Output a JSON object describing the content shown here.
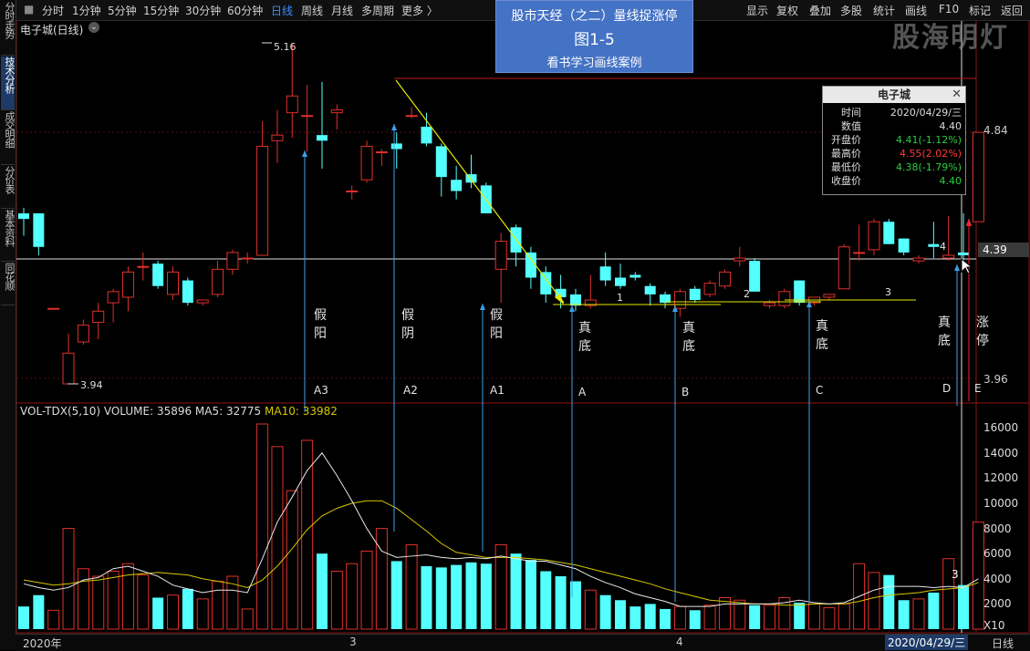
{
  "toolbar": {
    "items": [
      "分时",
      "1分钟",
      "5分钟",
      "15分钟",
      "30分钟",
      "60分钟",
      "日线",
      "周线",
      "月线",
      "多周期",
      "更多 〉"
    ],
    "right_items": [
      "显示",
      "复权",
      "叠加",
      "多股",
      "统计",
      "画线",
      "F10",
      "标记",
      "返回"
    ]
  },
  "left_tabs": [
    "分时走势",
    "技术分析",
    "成交明细",
    "分价表",
    "基本资料",
    "同花顺"
  ],
  "chart_header": {
    "stock_title": "电子城(日线)"
  },
  "banner": {
    "line1": "股市天经（之二）量线捉涨停",
    "line2": "图1-5",
    "line3": "看书学习画线案例"
  },
  "watermark": "股海明灯",
  "info_box": {
    "title": "电子城",
    "rows": [
      {
        "k": "时间",
        "v": "2020/04/29/三",
        "color": "#dddddd"
      },
      {
        "k": "数值",
        "v": "4.40",
        "color": "#dddddd"
      },
      {
        "k": "开盘价",
        "v": "4.41(-1.12%)",
        "color": "#2ecc40"
      },
      {
        "k": "最高价",
        "v": "4.55(2.02%)",
        "color": "#ff3b3b"
      },
      {
        "k": "最低价",
        "v": "4.38(-1.79%)",
        "color": "#2ecc40"
      },
      {
        "k": "收盘价",
        "v": "4.40",
        "color": "#2ecc40"
      }
    ]
  },
  "price_axis": {
    "labels": [
      "4.84",
      "4.39",
      "3.96"
    ]
  },
  "price_marks": {
    "high": "5.16",
    "low": "3.94"
  },
  "annotations": {
    "vertical_texts": [
      {
        "text": "假阳",
        "label": "A3"
      },
      {
        "text": "假阴",
        "label": "A2"
      },
      {
        "text": "假阳",
        "label": "A1"
      },
      {
        "text": "真底",
        "label": "A"
      },
      {
        "text": "真底",
        "label": "B"
      },
      {
        "text": "真底",
        "label": "C"
      },
      {
        "text": "真底",
        "label": "D"
      },
      {
        "text": "涨停",
        "label": "E"
      }
    ],
    "line_nums": [
      "1",
      "2",
      "3",
      "4"
    ]
  },
  "volume": {
    "header": "VOL-TDX(5,10) VOLUME: 35896 MA5: 32775",
    "ma10_label": "MA10: 33982",
    "axis_labels": [
      "16000",
      "14000",
      "12000",
      "10000",
      "8000",
      "6000",
      "4000",
      "2000"
    ],
    "unit": "X10",
    "marker3": "3"
  },
  "date_axis": {
    "labels": [
      "2020年",
      "3",
      "4"
    ],
    "current": "2020/04/29/三",
    "period": "日线"
  },
  "colors": {
    "up": "#e0302a",
    "down": "#54ffff",
    "ma5": "#e8e8e8",
    "ma10": "#d8c800",
    "accent": "#3a8cff"
  },
  "chart_data": {
    "type": "candlestick",
    "candles": [
      {
        "o": 4.55,
        "h": 4.57,
        "l": 4.47,
        "c": 4.53
      },
      {
        "o": 4.55,
        "h": 4.55,
        "l": 4.4,
        "c": 4.43
      },
      {
        "o": 4.21,
        "h": 4.21,
        "l": 4.21,
        "c": 4.21
      },
      {
        "o": 3.94,
        "h": 4.12,
        "l": 3.94,
        "c": 4.05
      },
      {
        "o": 4.09,
        "h": 4.17,
        "l": 4.08,
        "c": 4.15
      },
      {
        "o": 4.16,
        "h": 4.23,
        "l": 4.1,
        "c": 4.2
      },
      {
        "o": 4.23,
        "h": 4.28,
        "l": 4.16,
        "c": 4.27
      },
      {
        "o": 4.25,
        "h": 4.36,
        "l": 4.2,
        "c": 4.34
      },
      {
        "o": 4.36,
        "h": 4.41,
        "l": 4.31,
        "c": 4.36
      },
      {
        "o": 4.37,
        "h": 4.38,
        "l": 4.28,
        "c": 4.29
      },
      {
        "o": 4.26,
        "h": 4.36,
        "l": 4.24,
        "c": 4.34
      },
      {
        "o": 4.31,
        "h": 4.32,
        "l": 4.22,
        "c": 4.23
      },
      {
        "o": 4.23,
        "h": 4.24,
        "l": 4.22,
        "c": 4.24
      },
      {
        "o": 4.26,
        "h": 4.38,
        "l": 4.25,
        "c": 4.35
      },
      {
        "o": 4.35,
        "h": 4.42,
        "l": 4.33,
        "c": 4.41
      },
      {
        "o": 4.39,
        "h": 4.41,
        "l": 4.37,
        "c": 4.39
      },
      {
        "o": 4.4,
        "h": 4.88,
        "l": 4.4,
        "c": 4.79
      },
      {
        "o": 4.81,
        "h": 4.92,
        "l": 4.73,
        "c": 4.83
      },
      {
        "o": 4.91,
        "h": 5.16,
        "l": 4.82,
        "c": 4.97
      },
      {
        "o": 4.9,
        "h": 5.01,
        "l": 4.77,
        "c": 4.9
      },
      {
        "o": 4.83,
        "h": 5.02,
        "l": 4.71,
        "c": 4.81
      },
      {
        "o": 4.91,
        "h": 4.94,
        "l": 4.85,
        "c": 4.92
      },
      {
        "o": 4.63,
        "h": 4.65,
        "l": 4.6,
        "c": 4.63
      },
      {
        "o": 4.67,
        "h": 4.81,
        "l": 4.66,
        "c": 4.79
      },
      {
        "o": 4.77,
        "h": 4.78,
        "l": 4.72,
        "c": 4.77
      },
      {
        "o": 4.8,
        "h": 4.84,
        "l": 4.71,
        "c": 4.78
      },
      {
        "o": 4.9,
        "h": 4.93,
        "l": 4.89,
        "c": 4.9
      },
      {
        "o": 4.86,
        "h": 4.91,
        "l": 4.79,
        "c": 4.8
      },
      {
        "o": 4.79,
        "h": 4.8,
        "l": 4.61,
        "c": 4.68
      },
      {
        "o": 4.67,
        "h": 4.72,
        "l": 4.6,
        "c": 4.63
      },
      {
        "o": 4.69,
        "h": 4.76,
        "l": 4.64,
        "c": 4.66
      },
      {
        "o": 4.65,
        "h": 4.66,
        "l": 4.55,
        "c": 4.55
      },
      {
        "o": 4.35,
        "h": 4.48,
        "l": 4.23,
        "c": 4.45
      },
      {
        "o": 4.5,
        "h": 4.51,
        "l": 4.36,
        "c": 4.41
      },
      {
        "o": 4.41,
        "h": 4.43,
        "l": 4.28,
        "c": 4.32
      },
      {
        "o": 4.34,
        "h": 4.36,
        "l": 4.23,
        "c": 4.26
      },
      {
        "o": 4.28,
        "h": 4.33,
        "l": 4.21,
        "c": 4.25
      },
      {
        "o": 4.26,
        "h": 4.28,
        "l": 4.2,
        "c": 4.22
      },
      {
        "o": 4.22,
        "h": 4.33,
        "l": 4.21,
        "c": 4.24
      },
      {
        "o": 4.36,
        "h": 4.41,
        "l": 4.29,
        "c": 4.31
      },
      {
        "o": 4.32,
        "h": 4.37,
        "l": 4.28,
        "c": 4.29
      },
      {
        "o": 4.33,
        "h": 4.34,
        "l": 4.31,
        "c": 4.32
      },
      {
        "o": 4.29,
        "h": 4.3,
        "l": 4.22,
        "c": 4.26
      },
      {
        "o": 4.26,
        "h": 4.27,
        "l": 4.21,
        "c": 4.23
      },
      {
        "o": 4.21,
        "h": 4.28,
        "l": 4.18,
        "c": 4.27
      },
      {
        "o": 4.28,
        "h": 4.29,
        "l": 4.23,
        "c": 4.24
      },
      {
        "o": 4.26,
        "h": 4.31,
        "l": 4.25,
        "c": 4.3
      },
      {
        "o": 4.29,
        "h": 4.35,
        "l": 4.28,
        "c": 4.34
      },
      {
        "o": 4.38,
        "h": 4.43,
        "l": 4.36,
        "c": 4.39
      },
      {
        "o": 4.38,
        "h": 4.39,
        "l": 4.27,
        "c": 4.27
      },
      {
        "o": 4.22,
        "h": 4.24,
        "l": 4.21,
        "c": 4.23
      },
      {
        "o": 4.22,
        "h": 4.28,
        "l": 4.21,
        "c": 4.27
      },
      {
        "o": 4.31,
        "h": 4.31,
        "l": 4.22,
        "c": 4.23
      },
      {
        "o": 4.23,
        "h": 4.25,
        "l": 4.22,
        "c": 4.25
      },
      {
        "o": 4.25,
        "h": 4.26,
        "l": 4.24,
        "c": 4.26
      },
      {
        "o": 4.28,
        "h": 4.44,
        "l": 4.28,
        "c": 4.43
      },
      {
        "o": 4.41,
        "h": 4.51,
        "l": 4.38,
        "c": 4.41
      },
      {
        "o": 4.42,
        "h": 4.53,
        "l": 4.4,
        "c": 4.52
      },
      {
        "o": 4.52,
        "h": 4.53,
        "l": 4.44,
        "c": 4.44
      },
      {
        "o": 4.46,
        "h": 4.46,
        "l": 4.4,
        "c": 4.41
      },
      {
        "o": 4.38,
        "h": 4.4,
        "l": 4.37,
        "c": 4.39
      },
      {
        "o": 4.44,
        "h": 4.52,
        "l": 4.39,
        "c": 4.43
      },
      {
        "o": 4.39,
        "h": 4.54,
        "l": 4.38,
        "c": 4.4
      },
      {
        "o": 4.41,
        "h": 4.55,
        "l": 4.38,
        "c": 4.4
      },
      {
        "o": 4.52,
        "h": 4.84,
        "l": 4.52,
        "c": 4.84
      }
    ],
    "volume": [
      1800,
      2700,
      1500,
      8000,
      4800,
      4200,
      4600,
      5200,
      4300,
      2500,
      2700,
      3200,
      2400,
      3800,
      4200,
      1600,
      16300,
      14500,
      11000,
      15000,
      6000,
      4600,
      5200,
      6200,
      8000,
      5400,
      6700,
      5000,
      4900,
      5100,
      5300,
      5200,
      6700,
      6000,
      5500,
      4600,
      4200,
      3800,
      3100,
      2700,
      2300,
      1800,
      2000,
      1600,
      1800,
      1500,
      1900,
      2500,
      2300,
      1900,
      1900,
      2500,
      2100,
      2000,
      1700,
      2000,
      5200,
      4500,
      4300,
      2300,
      2400,
      2900,
      5600,
      3500,
      8500
    ],
    "ma5": [
      3600,
      3300,
      3100,
      3300,
      3900,
      4100,
      4800,
      5000,
      4600,
      4200,
      3500,
      3200,
      2900,
      3100,
      3100,
      2900,
      5600,
      8500,
      10500,
      12600,
      14000,
      12200,
      10200,
      8000,
      6200,
      5700,
      5800,
      5900,
      5700,
      5600,
      5700,
      5600,
      5800,
      5600,
      5400,
      5400,
      5100,
      4800,
      4200,
      3700,
      3300,
      2800,
      2500,
      2200,
      1800,
      1800,
      1800,
      2000,
      2000,
      2000,
      2000,
      2100,
      2300,
      2100,
      2000,
      2100,
      2600,
      3100,
      3400,
      3400,
      3400,
      3300,
      3400,
      3300,
      4000
    ],
    "ma10": [
      3900,
      3700,
      3500,
      3600,
      3800,
      3900,
      4100,
      4300,
      4400,
      4500,
      4400,
      4300,
      4000,
      3800,
      3600,
      3300,
      3900,
      5000,
      6400,
      7900,
      9000,
      9600,
      10000,
      10200,
      10200,
      9600,
      8700,
      7800,
      6800,
      6100,
      5900,
      5700,
      5700,
      5700,
      5600,
      5500,
      5300,
      5100,
      4800,
      4500,
      4200,
      3900,
      3600,
      3200,
      2900,
      2600,
      2300,
      2200,
      2100,
      2000,
      2000,
      1900,
      1900,
      2000,
      2000,
      2000,
      2200,
      2500,
      2700,
      2800,
      2900,
      3100,
      3200,
      3300,
      3700
    ],
    "ylim_price": [
      3.94,
      5.16
    ],
    "ylim_volume": [
      0,
      16300
    ]
  }
}
